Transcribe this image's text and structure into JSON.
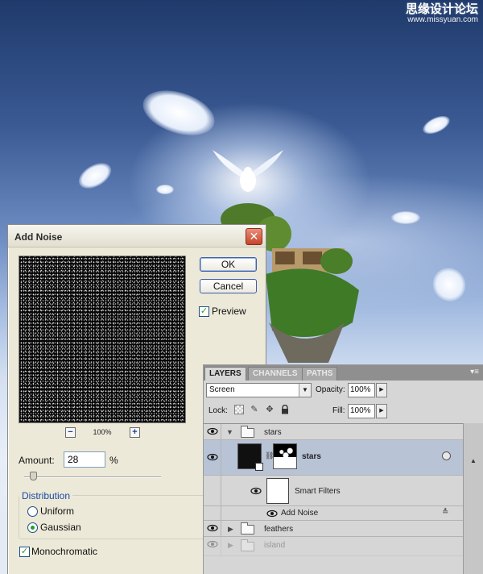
{
  "watermark": {
    "main": "思缘设计论坛",
    "sub": "www.missyuan.com"
  },
  "dialog": {
    "title": "Add Noise",
    "ok_label": "OK",
    "cancel_label": "Cancel",
    "preview_label": "Preview",
    "preview_checked": true,
    "zoom_level": "100%",
    "zoom_out_label": "−",
    "zoom_in_label": "+",
    "amount_label": "Amount:",
    "amount_value": "28",
    "amount_unit": "%",
    "amount_slider_fraction": 0.07,
    "distribution_legend": "Distribution",
    "distribution_options": [
      {
        "label": "Uniform",
        "selected": false
      },
      {
        "label": "Gaussian",
        "selected": true
      }
    ],
    "monochromatic_label": "Monochromatic",
    "monochromatic_checked": true,
    "close_glyph": "✕"
  },
  "layers_panel": {
    "tabs": [
      {
        "label": "LAYERS",
        "active": true
      },
      {
        "label": "CHANNELS",
        "active": false
      },
      {
        "label": "PATHS",
        "active": false
      }
    ],
    "menu_glyph": "▾≡",
    "blend_mode": "Screen",
    "opacity_label": "Opacity:",
    "opacity_value": "100%",
    "lock_label": "Lock:",
    "fill_label": "Fill:",
    "fill_value": "100%",
    "layers": [
      {
        "name": "stars",
        "kind": "group",
        "expanded": true
      },
      {
        "name": "stars",
        "kind": "smart-object",
        "selected": true
      },
      {
        "name": "Smart Filters",
        "kind": "smart-filters"
      },
      {
        "name": "Add Noise",
        "kind": "filter"
      },
      {
        "name": "feathers",
        "kind": "group",
        "expanded": false
      },
      {
        "name": "island",
        "kind": "group",
        "expanded": false
      }
    ]
  },
  "colors": {
    "dialog_bg": "#ece9d8",
    "accent_blue": "#1b4aa5",
    "check_green": "#22a122",
    "selected_layer": "#b9c3d6",
    "panel_bg": "#d6d6d6"
  }
}
